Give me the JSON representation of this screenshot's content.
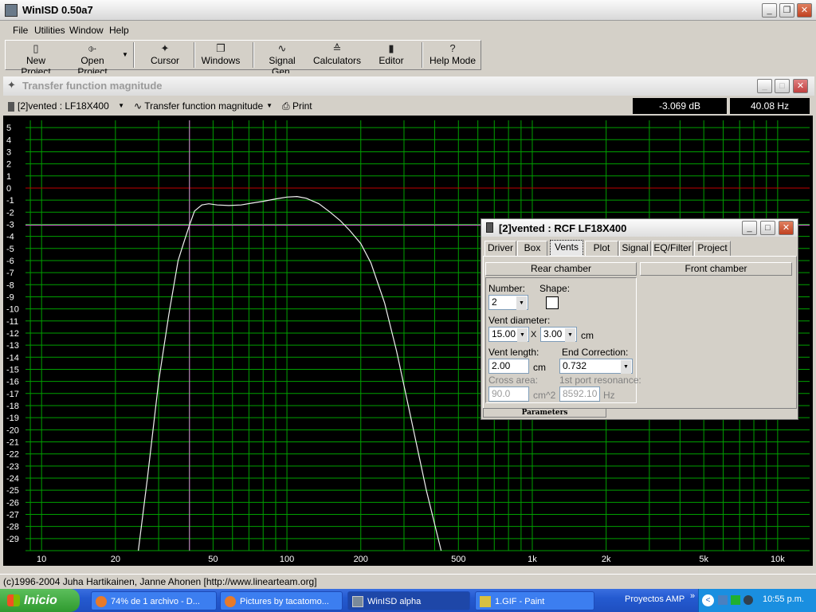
{
  "app": {
    "title": "WinISD 0.50a7"
  },
  "menu": [
    "File",
    "Utilities",
    "Window",
    "Help"
  ],
  "toolbar": {
    "new_project": "New Project",
    "open_project": "Open Project",
    "cursor": "Cursor",
    "windows": "Windows",
    "signal_gen": "Signal Gen.",
    "calculators": "Calculators",
    "editor": "Editor",
    "help_mode": "Help Mode"
  },
  "graph_window": {
    "title": "Transfer function magnitude",
    "project_select": "[2]vented : LF18X400",
    "graph_select": "Transfer function magnitude",
    "print": "Print",
    "cursor_db": "-3.069 dB",
    "cursor_hz": "40.08 Hz"
  },
  "chart_data": {
    "type": "line",
    "title": "",
    "xlabel": "",
    "ylabel": "",
    "x_scale": "log",
    "xlim": [
      8.6,
      13500
    ],
    "ylim": [
      -30,
      5.6
    ],
    "x_ticks": [
      10,
      20,
      50,
      100,
      200,
      500,
      1000,
      2000,
      5000,
      10000
    ],
    "x_tick_labels": [
      "10",
      "20",
      "50",
      "100",
      "200",
      "500",
      "1k",
      "2k",
      "5k",
      "10k"
    ],
    "y_ticks": [
      5,
      4,
      3,
      2,
      1,
      0,
      -1,
      -2,
      -3,
      -4,
      -5,
      -6,
      -7,
      -8,
      -9,
      -10,
      -11,
      -12,
      -13,
      -14,
      -15,
      -16,
      -17,
      -18,
      -19,
      -20,
      -21,
      -22,
      -23,
      -24,
      -25,
      -26,
      -27,
      -28,
      -29
    ],
    "grid": true,
    "reference_line_db": 0,
    "cursor": {
      "x": 40.08,
      "y": -3.069
    },
    "series": [
      {
        "x": [
          24.8,
          27,
          30,
          33,
          36,
          38,
          40.08,
          42,
          45,
          48,
          52,
          58,
          65,
          72,
          80,
          90,
          100,
          110,
          120,
          135,
          150,
          165,
          180,
          200,
          220,
          250,
          280,
          320,
          370,
          425
        ],
        "y": [
          -30,
          -24,
          -16,
          -10.5,
          -6,
          -4.5,
          -3.07,
          -1.9,
          -1.4,
          -1.3,
          -1.4,
          -1.45,
          -1.4,
          -1.25,
          -1.1,
          -0.9,
          -0.75,
          -0.7,
          -0.85,
          -1.3,
          -2.0,
          -2.7,
          -3.5,
          -4.6,
          -6.2,
          -9.5,
          -13.5,
          -19,
          -25,
          -30
        ]
      }
    ],
    "colors": {
      "background": "#000000",
      "grid": "#00a000",
      "curve": "#f0f0f0",
      "zero_line": "#c00000",
      "cursor": "#e070e0"
    }
  },
  "dialog": {
    "title": "[2]vented : RCF LF18X400",
    "tabs": [
      "Driver",
      "Box",
      "Vents",
      "Plot",
      "Signal",
      "EQ/Filter",
      "Project"
    ],
    "selected_tab": "Vents",
    "rear_chamber": "Rear chamber",
    "front_chamber": "Front chamber",
    "number_label": "Number:",
    "number_value": "2",
    "shape_label": "Shape:",
    "vent_diameter_label": "Vent diameter:",
    "vent_diameter_1": "15.00",
    "vent_diameter_x": "X",
    "vent_diameter_2": "3.00",
    "vent_diameter_unit": "cm",
    "vent_length_label": "Vent length:",
    "vent_length_value": "2.00",
    "vent_length_unit": "cm",
    "end_correction_label": "End Correction:",
    "end_correction_value": "0.732",
    "cross_area_label": "Cross area:",
    "cross_area_value": "90.0",
    "cross_area_unit": "cm^2",
    "port_resonance_label": "1st port resonance:",
    "port_resonance_value": "8592.10",
    "port_resonance_unit": "Hz",
    "parameters": "Parameters"
  },
  "status": {
    "text": "(c)1996-2004 Juha Hartikainen, Janne Ahonen [http://www.linearteam.org]"
  },
  "taskbar": {
    "start": "Inicio",
    "tasks": [
      "74% de 1 archivo - D...",
      "Pictures by tacatomo...",
      "WinISD alpha",
      "1.GIF - Paint"
    ],
    "toolbar_label": "Proyectos AMP",
    "clock": "10:55 p.m."
  }
}
